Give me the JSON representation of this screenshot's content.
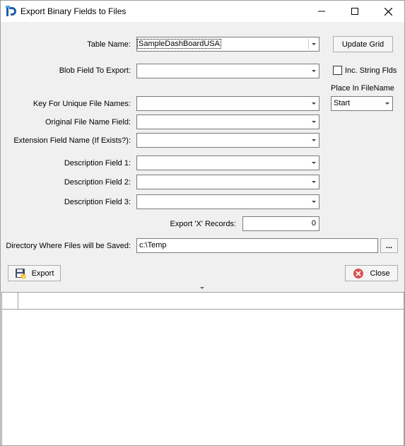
{
  "window": {
    "title": "Export Binary Fields to Files",
    "controls": {
      "minimize": "minimize-icon",
      "maximize": "maximize-icon",
      "close": "close-icon"
    }
  },
  "form": {
    "table_name": {
      "label": "Table Name:",
      "value": "SampleDashBoardUSA"
    },
    "blob_field": {
      "label": "Blob Field To Export:",
      "value": ""
    },
    "key_field": {
      "label": "Key For Unique File Names:",
      "value": ""
    },
    "original_name_field": {
      "label": "Original File Name Field:",
      "value": ""
    },
    "extension_field": {
      "label": "Extension Field Name (If Exists?):",
      "value": ""
    },
    "description1": {
      "label": "Description Field 1:",
      "value": ""
    },
    "description2": {
      "label": "Description Field 2:",
      "value": ""
    },
    "description3": {
      "label": "Description Field 3:",
      "value": ""
    },
    "export_records": {
      "label": "Export 'X' Records:",
      "value": "0"
    },
    "directory": {
      "label": "Directory Where Files will be Saved:",
      "value": "c:\\Temp",
      "browse_label": "..."
    }
  },
  "side": {
    "update_grid_label": "Update Grid",
    "inc_string_label": "Inc. String Flds",
    "inc_string_checked": false,
    "place_label": "Place In FileName",
    "place_value": "Start"
  },
  "actions": {
    "export_label": "Export",
    "close_label": "Close"
  },
  "colors": {
    "app_icon": "#1e5fa8",
    "close_icon": "#d9534f",
    "title_bg": "#ffffff",
    "dialog_bg": "#f0f0f0"
  }
}
